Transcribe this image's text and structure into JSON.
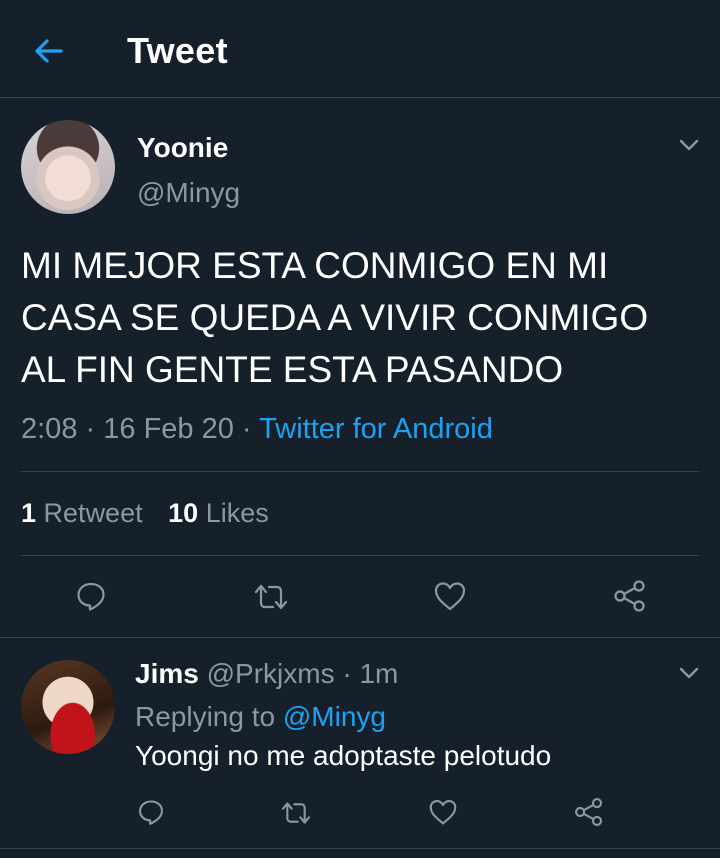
{
  "header": {
    "title": "Tweet"
  },
  "tweet": {
    "author_name": "Yoonie",
    "author_handle": "@Minyg",
    "text_lines": [
      "MI MEJOR ESTA CONMIGO EN MI",
      "CASA SE QUEDA A VIVIR CONMIGO",
      "AL FIN GENTE ESTA PASANDO"
    ],
    "time": "2:08",
    "date": "16 Feb 20",
    "separator": "·",
    "source": "Twitter for Android",
    "retweet_count": "1",
    "retweet_label": "Retweet",
    "like_count": "10",
    "like_label": "Likes"
  },
  "reply": {
    "author_name": "Jims",
    "author_handle": "@Prkjxms",
    "separator": "·",
    "time": "1m",
    "replying_prefix": "Replying to",
    "replying_to": "@Minyg",
    "text": "Yoongi no me adoptaste pelotudo"
  },
  "colors": {
    "background": "#15202b",
    "accent": "#1da1f2",
    "secondary_text": "#8899a6",
    "divider": "#38444d"
  },
  "icons": {
    "back": "arrow-left-icon",
    "caret": "chevron-down-icon",
    "reply": "comment-icon",
    "retweet": "retweet-icon",
    "like": "heart-icon",
    "share": "share-icon"
  }
}
